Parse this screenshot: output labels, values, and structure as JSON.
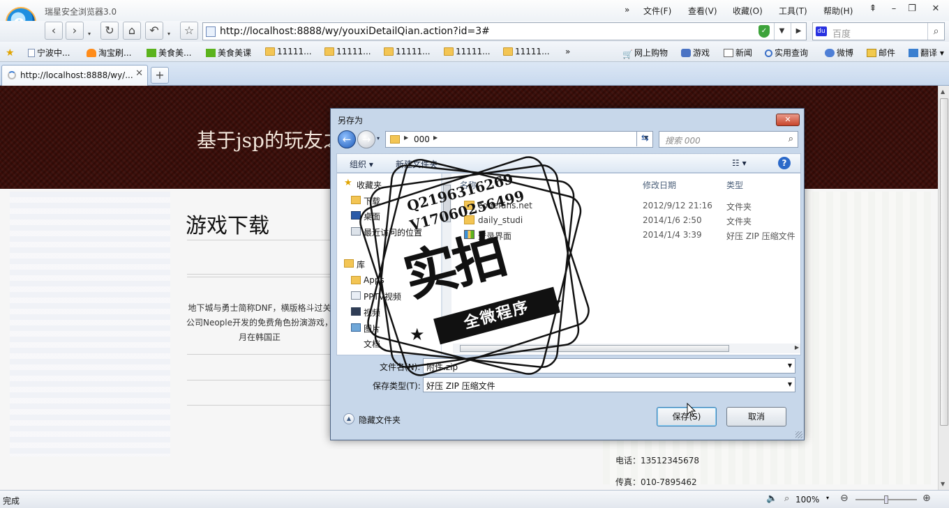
{
  "browser": {
    "app_title": "瑞星安全浏览器3.0",
    "menu": [
      "文件(F)",
      "查看(V)",
      "收藏(O)",
      "工具(T)",
      "帮助(H)"
    ],
    "menu_overflow": "»",
    "url": "http://localhost:8888/wy/youxiDetailQian.action?id=3#",
    "search_placeholder": "百度",
    "search_engine_icon": "baidu-paw-icon",
    "favorites": [
      {
        "label": "宁波中...",
        "icon": "page-icon"
      },
      {
        "label": "淘宝刷...",
        "icon": "taobao-icon"
      },
      {
        "label": "美食美...",
        "icon": "iqiyi-icon"
      },
      {
        "label": "美食美课",
        "icon": "iqiyi-icon"
      },
      {
        "label": "11111...",
        "icon": "folder-icon"
      },
      {
        "label": "11111...",
        "icon": "folder-icon"
      },
      {
        "label": "11111...",
        "icon": "folder-icon"
      },
      {
        "label": "11111...",
        "icon": "folder-icon"
      },
      {
        "label": "11111...",
        "icon": "folder-icon"
      }
    ],
    "favorites_overflow": "»",
    "quick_links": [
      {
        "label": "网上购物",
        "icon": "cart-icon"
      },
      {
        "label": "游戏",
        "icon": "gamepad-icon"
      },
      {
        "label": "新闻",
        "icon": "news-icon"
      },
      {
        "label": "实用查询",
        "icon": "magnifier-icon"
      },
      {
        "label": "微博",
        "icon": "weibo-icon"
      },
      {
        "label": "邮件",
        "icon": "mail-icon"
      },
      {
        "label": "翻译",
        "icon": "translate-icon"
      }
    ],
    "tab_label": "http://localhost:8888/wy/...",
    "status": "完成",
    "zoom": "100%",
    "zoom_fraction": 0.5
  },
  "page": {
    "site_title": "基于jsp的玩友之",
    "section_heading": "游戏下载",
    "description": "地下城与勇士简称DNF，横版格斗过关 公司Neople开发的免费角色扮演游戏， 月在韩国正",
    "phone": "电话：13512345678",
    "fax": "传真：010-7895462",
    "header_color": "#3a0d08"
  },
  "dialog": {
    "title": "另存为",
    "close_label": "✕",
    "path_folder": "000",
    "search_placeholder": "搜索 000",
    "toolbar": {
      "organize": "组织 ▾",
      "new_folder": "新建文件夹"
    },
    "nav_items": [
      {
        "label": "收藏夹",
        "icon": "star-icon"
      },
      {
        "label": "下载",
        "icon": "download-folder-icon"
      },
      {
        "label": "桌面",
        "icon": "desktop-icon"
      },
      {
        "label": "最近访问的位置",
        "icon": "recent-places-icon"
      },
      {
        "label": "库",
        "icon": "library-icon"
      },
      {
        "label": "Apps",
        "icon": "folder-icon"
      },
      {
        "label": "PPTV视频",
        "icon": "pptv-icon"
      },
      {
        "label": "视频",
        "icon": "video-library-icon"
      },
      {
        "label": "图片",
        "icon": "pictures-library-icon"
      },
      {
        "label": "文档",
        "icon": "documents-library-icon"
      }
    ],
    "columns": {
      "name": "名称",
      "date": "修改日期",
      "type": "类型"
    },
    "files": [
      {
        "name": "codefans.net",
        "date": "2012/9/12 21:16",
        "type": "文件夹",
        "icon": "folder-icon"
      },
      {
        "name": "daily_studi",
        "date": "2014/1/6 2:50",
        "type": "文件夹",
        "icon": "folder-icon"
      },
      {
        "name": "登录界面",
        "date": "2014/1/4 3:39",
        "type": "好压 ZIP 压缩文件",
        "icon": "zip-icon"
      }
    ],
    "filename_label": "文件名(N):",
    "filename_value": "附件.zip",
    "filetype_label": "保存类型(T):",
    "filetype_value": "好压 ZIP 压缩文件",
    "hide_folders": "隐藏文件夹",
    "save_button": "保存(S)",
    "cancel_button": "取消"
  },
  "watermark": {
    "line_q": "Q2196316269",
    "line_v": "V17060256499",
    "main": "实拍",
    "banner": "全微程序"
  }
}
